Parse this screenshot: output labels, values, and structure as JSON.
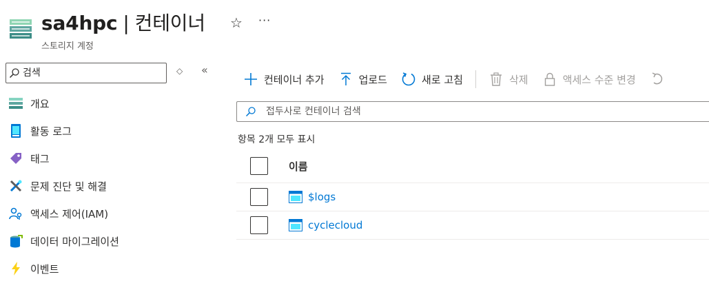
{
  "header": {
    "resource_name": "sa4hpc",
    "separator": "|",
    "section_title": "컨테이너",
    "subtitle": "스토리지 계정",
    "icons": {
      "resource": "storage-account-icon",
      "favorite": "star-icon",
      "more": "more-icon"
    }
  },
  "sidebar": {
    "search_placeholder": "검색",
    "items": [
      {
        "label": "개요",
        "icon": "overview-icon"
      },
      {
        "label": "활동 로그",
        "icon": "activity-log-icon"
      },
      {
        "label": "태그",
        "icon": "tag-icon"
      },
      {
        "label": "문제 진단 및 해결",
        "icon": "diagnose-icon"
      },
      {
        "label": "액세스 제어(IAM)",
        "icon": "iam-icon"
      },
      {
        "label": "데이터 마이그레이션",
        "icon": "data-migration-icon"
      },
      {
        "label": "이벤트",
        "icon": "events-icon"
      }
    ]
  },
  "toolbar": {
    "add_container": "컨테이너 추가",
    "upload": "업로드",
    "refresh": "새로 고침",
    "delete": "삭제",
    "change_access_level": "액세스 수준 변경"
  },
  "container_search": {
    "placeholder": "접두사로 컨테이너 검색"
  },
  "list": {
    "count_label": "항목 2개 모두 표시",
    "column_name": "이름",
    "rows": [
      {
        "name": "$logs"
      },
      {
        "name": "cyclecloud"
      }
    ]
  },
  "colors": {
    "link": "#0078d4",
    "accent": "#0078d4",
    "disabled": "#a19f9d",
    "text": "#323130"
  }
}
